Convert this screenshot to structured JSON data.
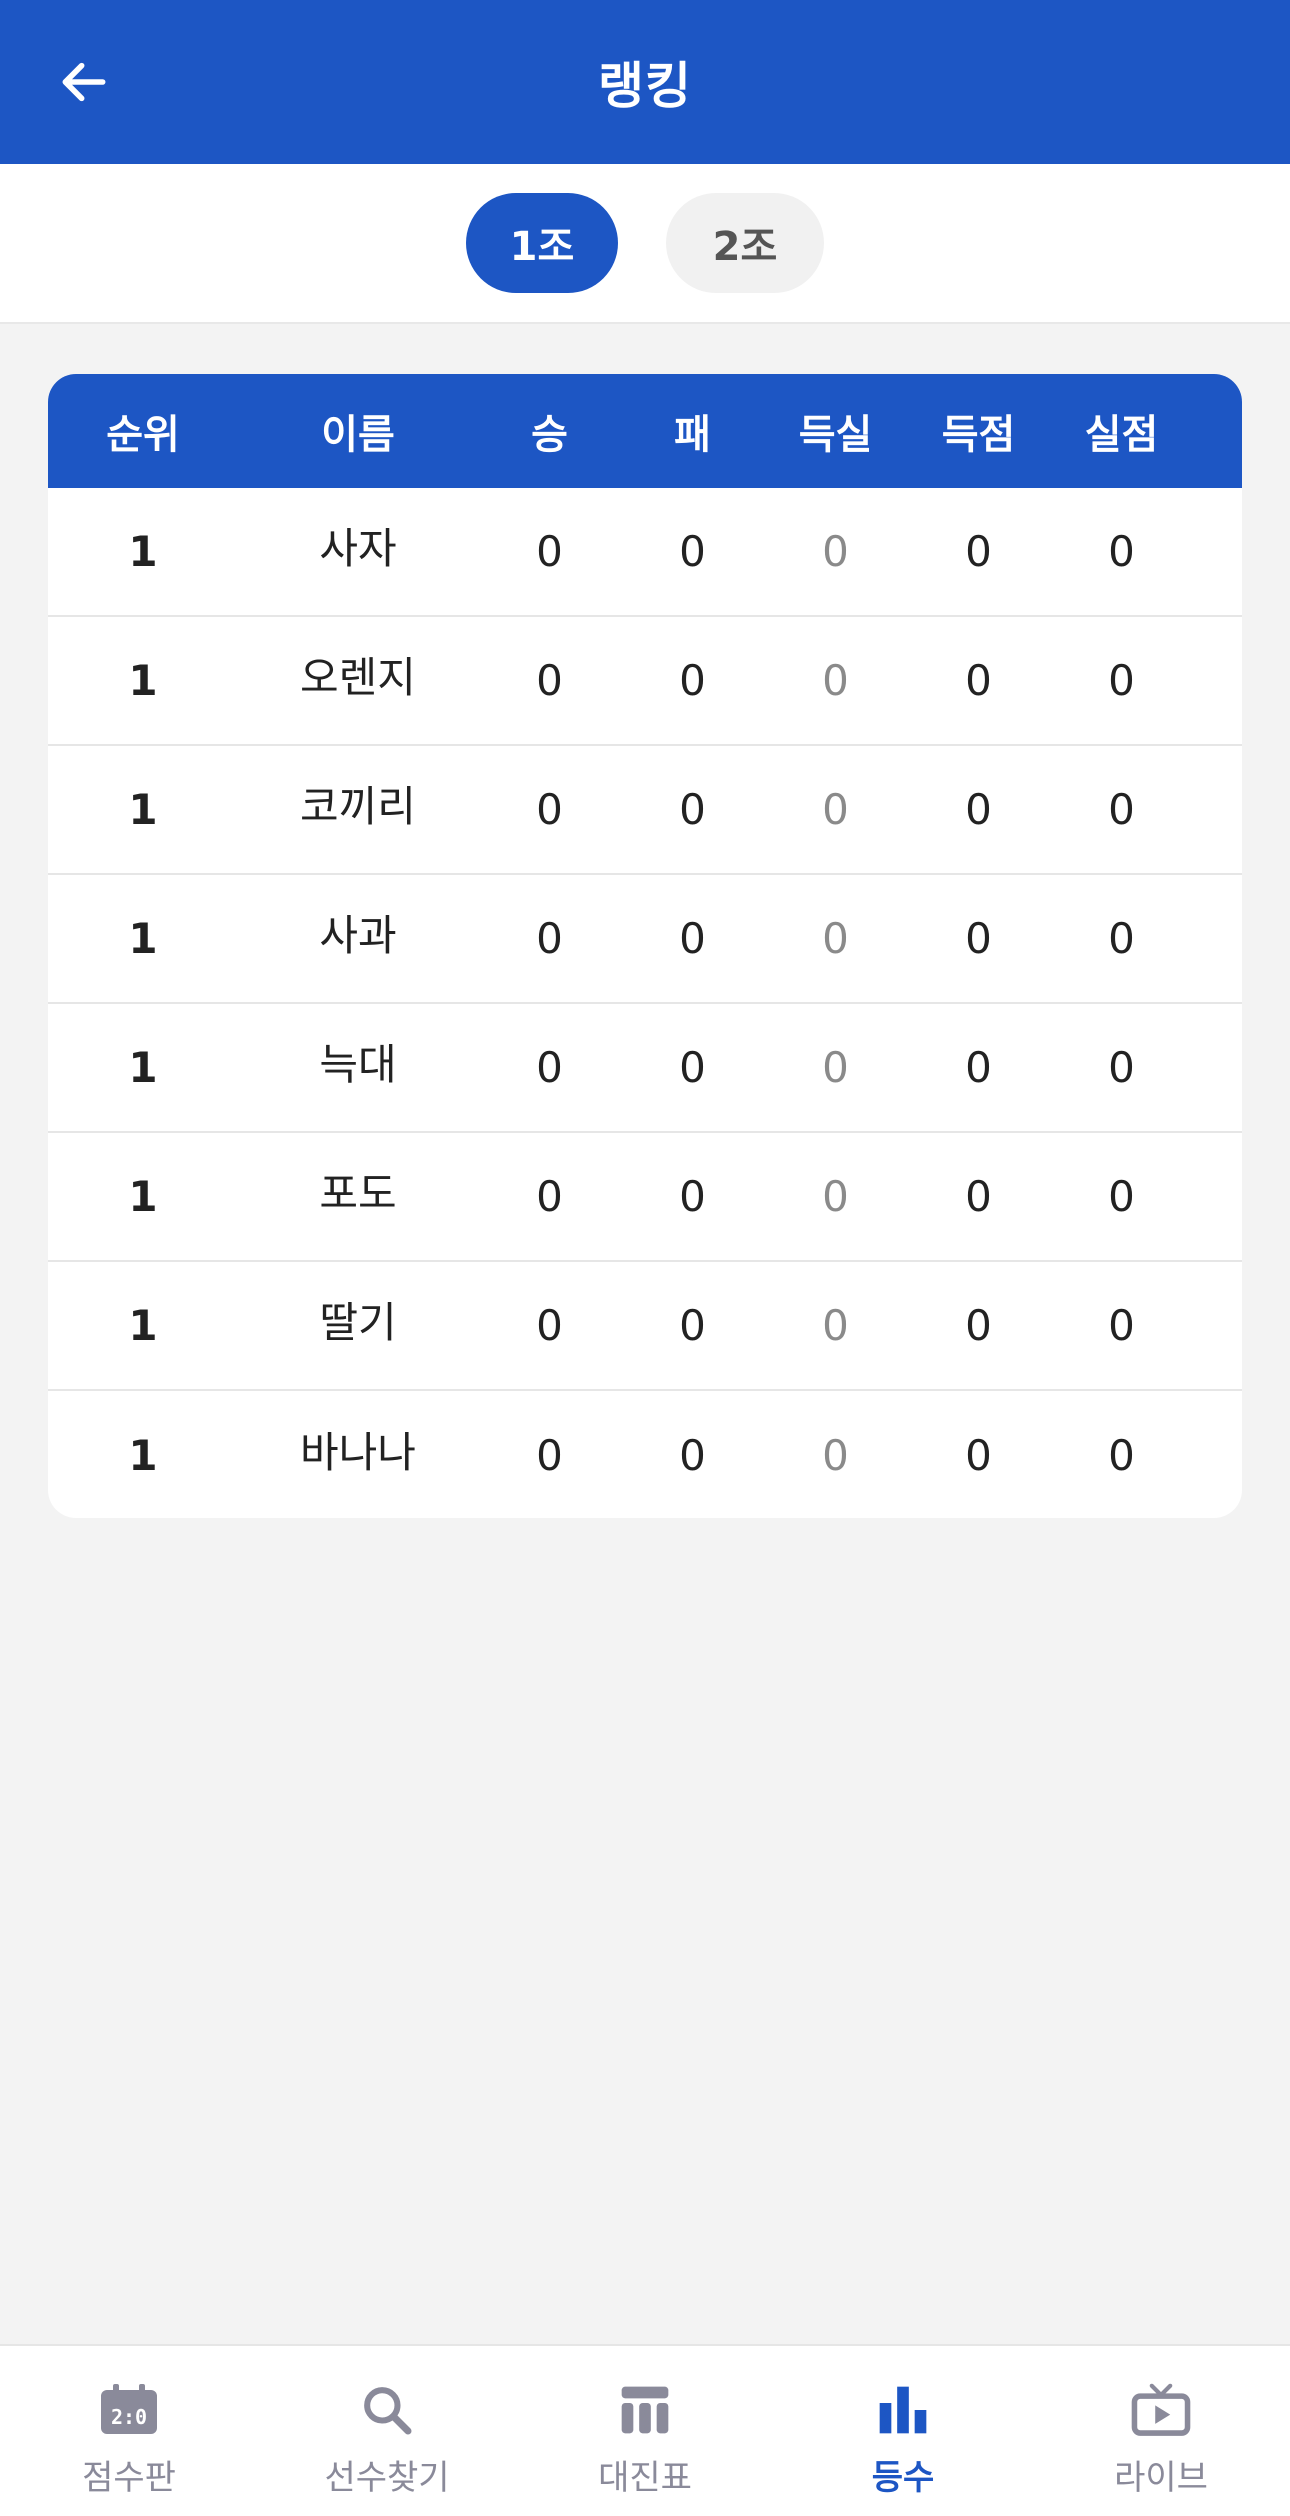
{
  "header": {
    "title": "랭킹"
  },
  "groups": [
    {
      "label": "1조",
      "active": true
    },
    {
      "label": "2조",
      "active": false
    }
  ],
  "table": {
    "columns": [
      "순위",
      "이름",
      "승",
      "패",
      "득실",
      "득점",
      "실점"
    ],
    "rows": [
      {
        "rank": "1",
        "name": "사자",
        "win": "0",
        "loss": "0",
        "diff": "0",
        "scored": "0",
        "conceded": "0"
      },
      {
        "rank": "1",
        "name": "오렌지",
        "win": "0",
        "loss": "0",
        "diff": "0",
        "scored": "0",
        "conceded": "0"
      },
      {
        "rank": "1",
        "name": "코끼리",
        "win": "0",
        "loss": "0",
        "diff": "0",
        "scored": "0",
        "conceded": "0"
      },
      {
        "rank": "1",
        "name": "사과",
        "win": "0",
        "loss": "0",
        "diff": "0",
        "scored": "0",
        "conceded": "0"
      },
      {
        "rank": "1",
        "name": "늑대",
        "win": "0",
        "loss": "0",
        "diff": "0",
        "scored": "0",
        "conceded": "0"
      },
      {
        "rank": "1",
        "name": "포도",
        "win": "0",
        "loss": "0",
        "diff": "0",
        "scored": "0",
        "conceded": "0"
      },
      {
        "rank": "1",
        "name": "딸기",
        "win": "0",
        "loss": "0",
        "diff": "0",
        "scored": "0",
        "conceded": "0"
      },
      {
        "rank": "1",
        "name": "바나나",
        "win": "0",
        "loss": "0",
        "diff": "0",
        "scored": "0",
        "conceded": "0"
      }
    ]
  },
  "nav": {
    "items": [
      {
        "label": "점수판",
        "icon": "scoreboard-icon",
        "active": false
      },
      {
        "label": "선수찾기",
        "icon": "search-icon",
        "active": false
      },
      {
        "label": "대진표",
        "icon": "bracket-table-icon",
        "active": false
      },
      {
        "label": "등수",
        "icon": "bar-chart-icon",
        "active": true
      },
      {
        "label": "라이브",
        "icon": "tv-icon",
        "active": false
      }
    ]
  },
  "colors": {
    "primary": "#1d56c4",
    "background": "#f3f3f3",
    "nav_inactive": "#8a8a9a"
  }
}
